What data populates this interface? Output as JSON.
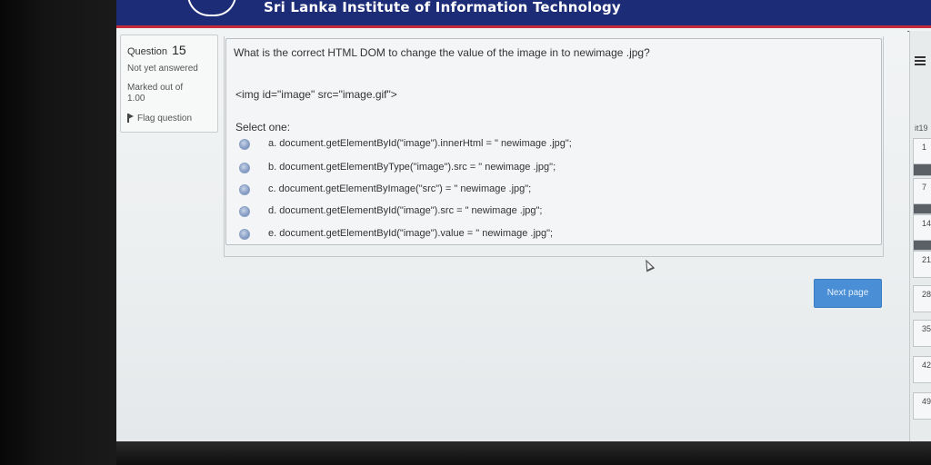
{
  "header": {
    "site_title": "Sri Lanka Institute of Information Technology"
  },
  "info": {
    "question_label": "Question",
    "question_number": "15",
    "status": "Not yet answered",
    "marked_out_of": "Marked out of",
    "mark_value": "1.00",
    "flag_label": "Flag question"
  },
  "question": {
    "text": "What is the correct HTML DOM to change the value of the image in to newimage .jpg?",
    "code": "<img id=\"image\" src=\"image.gif\">",
    "select_one": "Select one:",
    "options": [
      {
        "label": "a. document.getElementById(\"image\").innerHtml = \" newimage .jpg\";"
      },
      {
        "label": "b. document.getElementByType(\"image\").src = \" newimage .jpg\";"
      },
      {
        "label": "c. document.getElementByImage(\"src\") = \" newimage .jpg\";"
      },
      {
        "label": "d. document.getElementById(\"image\").src = \" newimage .jpg\";"
      },
      {
        "label": "e. document.getElementById(\"image\").value = \" newimage .jpg\";"
      }
    ]
  },
  "navigation": {
    "next_button": "Next page",
    "nav_token": "it19",
    "nav_numbers": [
      "1",
      "7",
      "14",
      "21",
      "28",
      "35",
      "42",
      "49"
    ]
  },
  "colors": {
    "header_bg": "#1c2c77",
    "header_accent": "#c62b3a",
    "button": "#4a8fd6"
  },
  "icons": [
    "flag-icon",
    "radio-icon",
    "hamburger-icon",
    "cursor-icon"
  ]
}
